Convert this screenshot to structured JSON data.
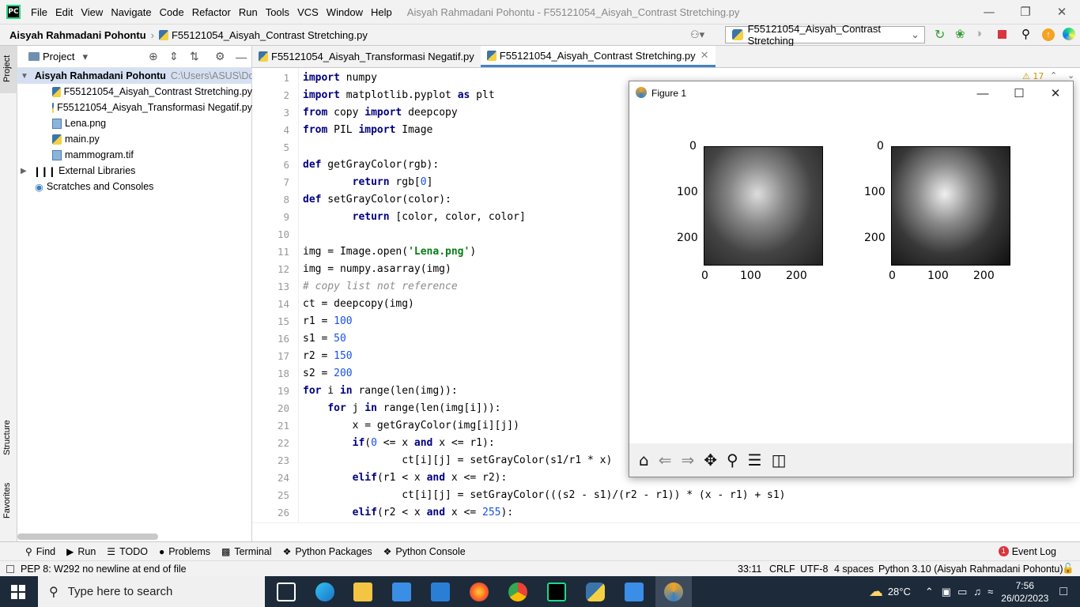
{
  "menubar": {
    "logo": "PC",
    "items": [
      "File",
      "Edit",
      "View",
      "Navigate",
      "Code",
      "Refactor",
      "Run",
      "Tools",
      "VCS",
      "Window",
      "Help"
    ],
    "title": "Aisyah Rahmadani Pohontu - F55121054_Aisyah_Contrast Stretching.py"
  },
  "navbar": {
    "project": "Aisyah Rahmadani Pohontu",
    "file": "F55121054_Aisyah_Contrast Stretching.py",
    "run_config": "F55121054_Aisyah_Contrast Stretching"
  },
  "left_strip": {
    "project": "Project",
    "structure": "Structure",
    "favorites": "Favorites"
  },
  "project_panel": {
    "title": "Project",
    "root": "Aisyah Rahmadani Pohontu",
    "root_path": "C:\\Users\\ASUS\\Doc",
    "files": [
      "F55121054_Aisyah_Contrast Stretching.py",
      "F55121054_Aisyah_Transformasi Negatif.py",
      "Lena.png",
      "main.py",
      "mammogram.tif"
    ],
    "external": "External Libraries",
    "scratches": "Scratches and Consoles"
  },
  "tabs": [
    "F55121054_Aisyah_Transformasi Negatif.py",
    "F55121054_Aisyah_Contrast Stretching.py"
  ],
  "inspections": "17",
  "code_lines": [
    {
      "n": "1",
      "html": "<span class='kw'>import</span> numpy"
    },
    {
      "n": "2",
      "html": "<span class='kw'>import</span> matplotlib.pyplot <span class='kw'>as</span> plt"
    },
    {
      "n": "3",
      "html": "<span class='kw'>from</span> copy <span class='kw'>import</span> deepcopy"
    },
    {
      "n": "4",
      "html": "<span class='kw'>from</span> PIL <span class='kw'>import</span> Image"
    },
    {
      "n": "5",
      "html": ""
    },
    {
      "n": "6",
      "html": "<span class='kw'>def</span> getGrayColor(rgb):"
    },
    {
      "n": "7",
      "html": "        <span class='kw'>return</span> rgb[<span class='num'>0</span>]"
    },
    {
      "n": "8",
      "html": "<span class='kw'>def</span> setGrayColor(color):"
    },
    {
      "n": "9",
      "html": "        <span class='kw'>return</span> [color, color, color]"
    },
    {
      "n": "10",
      "html": ""
    },
    {
      "n": "11",
      "html": "img = Image.open(<span class='str'>'Lena.png'</span>)"
    },
    {
      "n": "12",
      "html": "img = numpy.asarray(img)"
    },
    {
      "n": "13",
      "html": "<span class='cm'># copy list not reference</span>"
    },
    {
      "n": "14",
      "html": "ct = deepcopy(img)"
    },
    {
      "n": "15",
      "html": "r1 = <span class='num'>100</span>"
    },
    {
      "n": "16",
      "html": "s1 = <span class='num'>50</span>"
    },
    {
      "n": "17",
      "html": "r2 = <span class='num'>150</span>"
    },
    {
      "n": "18",
      "html": "s2 = <span class='num'>200</span>"
    },
    {
      "n": "19",
      "html": "<span class='kw'>for</span> i <span class='kw'>in</span> range(len(img)):"
    },
    {
      "n": "20",
      "html": "    <span class='kw'>for</span> j <span class='kw'>in</span> range(len(img[i])):"
    },
    {
      "n": "21",
      "html": "        x = getGrayColor(img[i][j])"
    },
    {
      "n": "22",
      "html": "        <span class='kw'>if</span>(<span class='num'>0</span> &lt;= x <span class='kw'>and</span> x &lt;= r1):"
    },
    {
      "n": "23",
      "html": "                ct[i][j] = setGrayColor(s1/r1 * x)"
    },
    {
      "n": "24",
      "html": "        <span class='kw'>elif</span>(r1 &lt; x <span class='kw'>and</span> x &lt;= r2):"
    },
    {
      "n": "25",
      "html": "                ct[i][j] = setGrayColor(((s2 - s1)/(r2 - r1)) * (x - r1) + s1)"
    },
    {
      "n": "26",
      "html": "        <span class='kw'>elif</span>(r2 &lt; x <span class='kw'>and</span> x &lt;= <span class='num'>255</span>):"
    }
  ],
  "figure": {
    "title": "Figure 1",
    "ticks_y": [
      "0",
      "100",
      "200"
    ],
    "ticks_x": [
      "0",
      "100",
      "200"
    ]
  },
  "toolwindows": [
    "Find",
    "Run",
    "TODO",
    "Problems",
    "Terminal",
    "Python Packages",
    "Python Console"
  ],
  "event_log": "Event Log",
  "event_count": "1",
  "status": {
    "message": "PEP 8: W292 no newline at end of file",
    "position": "33:11",
    "line_sep": "CRLF",
    "encoding": "UTF-8",
    "indent": "4 spaces",
    "interpreter": "Python 3.10 (Aisyah Rahmadani Pohontu)"
  },
  "taskbar": {
    "search_placeholder": "Type here to search",
    "temperature": "28°C",
    "time": "7:56",
    "date": "26/02/2023"
  }
}
